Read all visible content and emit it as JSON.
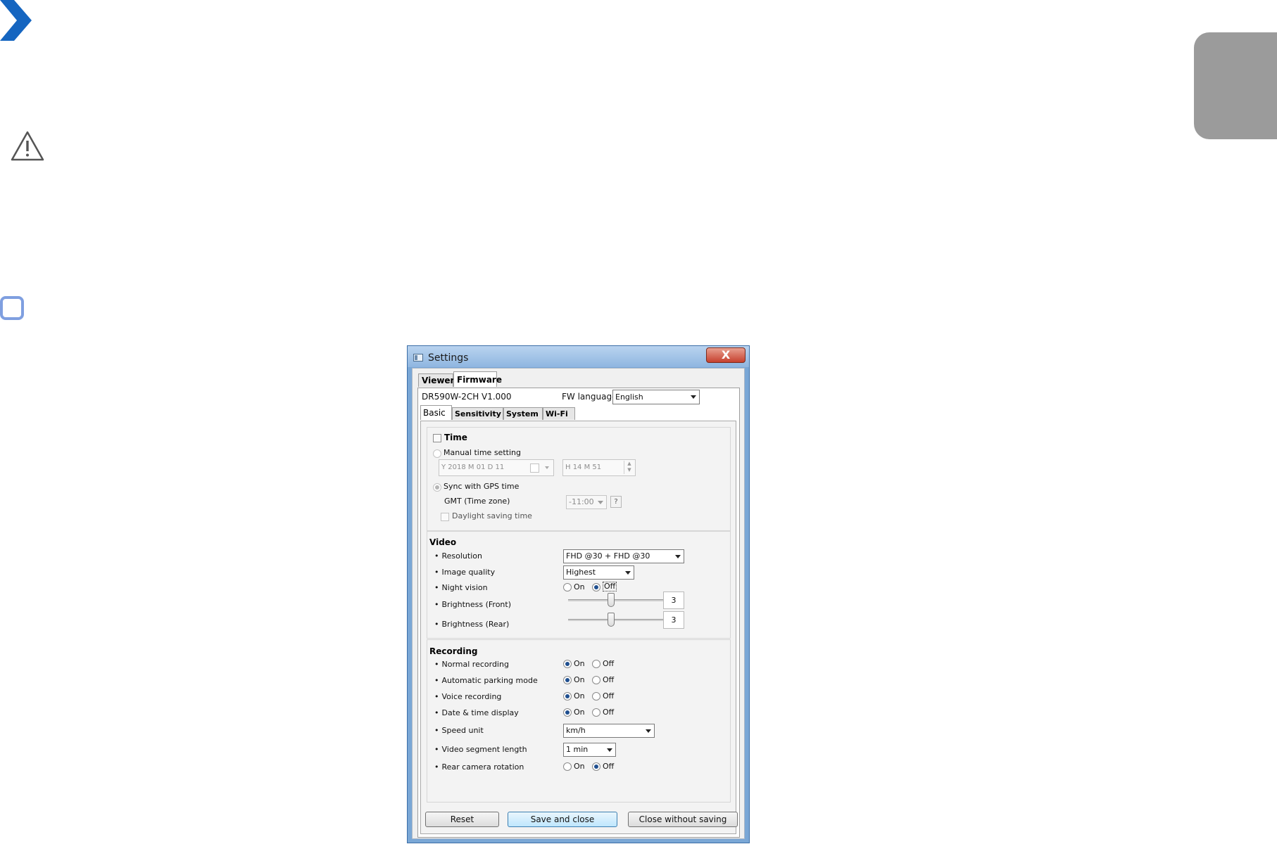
{
  "page": {
    "accent_colors": {
      "chevron": "#1565c0",
      "gray_tab": "#9b9b9b",
      "note_box": "#7f9fe0"
    },
    "icons": [
      "chevron-right-icon",
      "warning-icon",
      "note-icon"
    ]
  },
  "window": {
    "title": "Settings",
    "close_symbol": "X",
    "top_tabs": [
      "Viewer",
      "Firmware"
    ],
    "model": "DR590W-2CH",
    "version": "V1.000",
    "fw_language_label": "FW language",
    "fw_language_value": "English",
    "inner_tabs": [
      "Basic",
      "Sensitivity",
      "System",
      "Wi-Fi"
    ]
  },
  "time": {
    "title": "Time",
    "manual_label": "Manual time setting",
    "date_value": "Y 2018 M 01 D 11",
    "time_value": "H 14 M 51",
    "spin_up": "▲",
    "spin_down": "▼",
    "gps_label": "Sync with GPS time",
    "gmt_label": "GMT (Time zone)",
    "gmt_value": "-11:00",
    "help": "?",
    "dst_label": "Daylight saving time"
  },
  "video": {
    "title": "Video",
    "resolution_label": "Resolution",
    "resolution_value": "FHD @30 + FHD @30",
    "quality_label": "Image quality",
    "quality_value": "Highest",
    "night_label": "Night vision",
    "on": "On",
    "off": "Off",
    "bright_front_label": "Brightness (Front)",
    "bright_front_value": "3",
    "bright_rear_label": "Brightness (Rear)",
    "bright_rear_value": "3"
  },
  "recording": {
    "title": "Recording",
    "normal_label": "Normal recording",
    "parking_label": "Automatic parking mode",
    "voice_label": "Voice recording",
    "datetime_label": "Date & time display",
    "speed_label": "Speed unit",
    "speed_value": "km/h",
    "segment_label": "Video segment length",
    "segment_value": "1 min",
    "rear_rot_label": "Rear camera rotation",
    "on": "On",
    "off": "Off"
  },
  "buttons": {
    "reset": "Reset",
    "save": "Save and close",
    "close": "Close without saving"
  }
}
